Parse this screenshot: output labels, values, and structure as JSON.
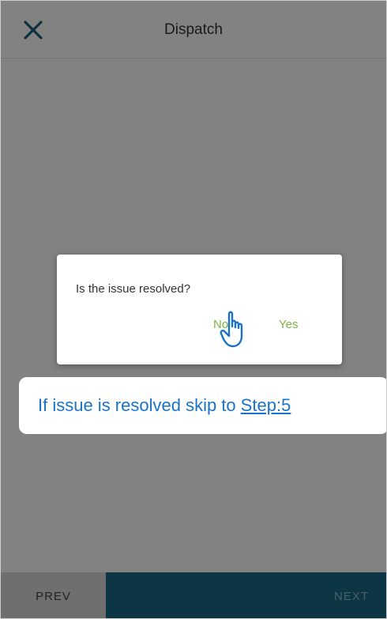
{
  "header": {
    "title": "Dispatch",
    "close_icon": "close-icon"
  },
  "footer": {
    "prev_label": "PREV",
    "next_label": "NEXT"
  },
  "dialog": {
    "question": "Is the issue resolved?",
    "no_label": "No",
    "yes_label": "Yes"
  },
  "callout": {
    "text": "If issue is resolved skip to",
    "link_text": "Step:5"
  },
  "colors": {
    "accent": "#1b6a85",
    "action_text": "#7cb342",
    "callout_text": "#1a73c9"
  },
  "icons": {
    "close": "close-icon",
    "pointer": "hand-pointer-icon"
  }
}
